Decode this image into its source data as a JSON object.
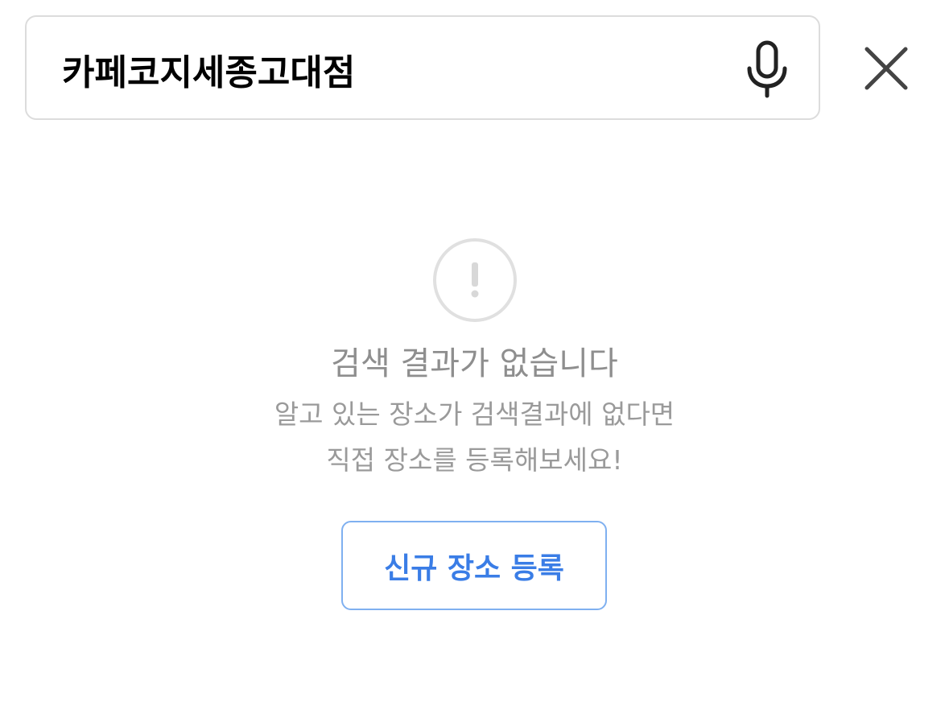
{
  "search": {
    "value": "카페코지세종고대점",
    "mic_icon": "microphone-icon",
    "close_icon": "close-icon"
  },
  "empty_state": {
    "icon": "exclamation-circle-icon",
    "title": "검색 결과가 없습니다",
    "description_line1": "알고 있는 장소가 검색결과에 없다면",
    "description_line2": "직접 장소를 등록해보세요!",
    "button_label": "신규 장소 등록"
  },
  "colors": {
    "button_accent": "#3a7de6",
    "button_border": "#7fb0f0",
    "muted_text": "#8e8e8e",
    "icon_gray": "#444444"
  }
}
